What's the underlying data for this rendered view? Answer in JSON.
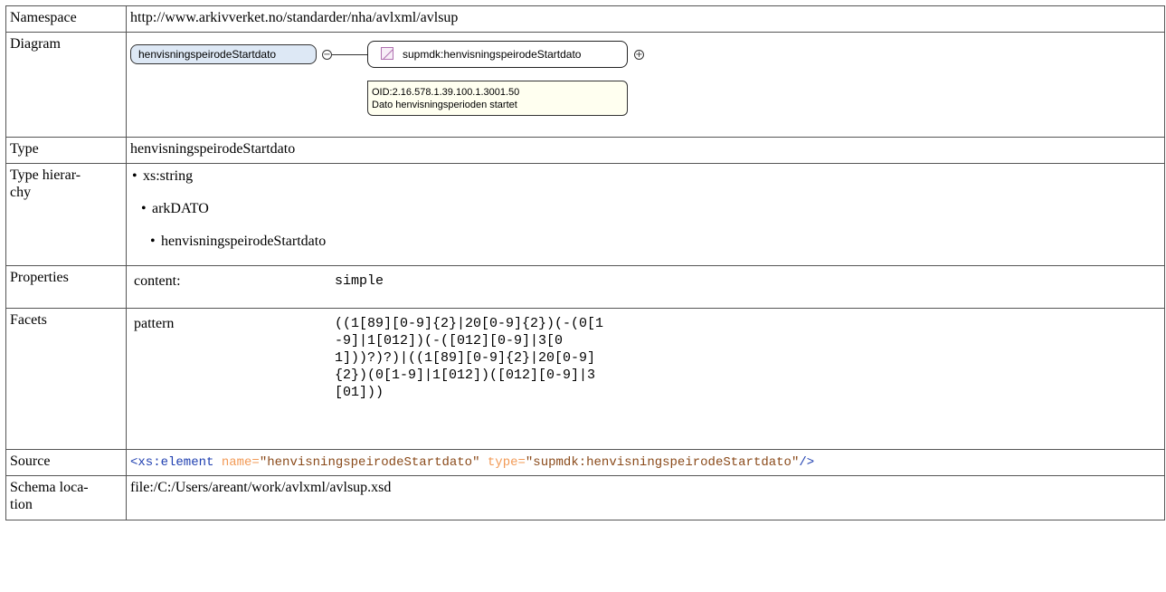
{
  "rows": {
    "namespace": {
      "label": "Namespace",
      "value": "http://www.arkivverket.no/standarder/nha/avlxml/avlsup"
    },
    "diagram": {
      "label": "Diagram",
      "element_name": "henvisningspeirodeStartdato",
      "type_name": "supmdk:henvisningspeirodeStartdato",
      "annotation_line1": "OID:2.16.578.1.39.100.1.3001.50",
      "annotation_line2": "Dato henvisningsperioden startet",
      "collapse_symbol": "−",
      "expand_symbol": "+"
    },
    "type": {
      "label": "Type",
      "value": "henvisningspeirodeStartdato"
    },
    "type_hierarchy": {
      "label_line1": "Type hierar-",
      "label_line2": "chy",
      "items": [
        "xs:string",
        "arkDATO",
        "henvisningspeirodeStartdato"
      ]
    },
    "properties": {
      "label": "Properties",
      "key": "content:",
      "value": "simple"
    },
    "facets": {
      "label": "Facets",
      "key": "pattern",
      "value": "((1[89][0-9]{2}|20[0-9]{2})(-(0[1-9]|1[012])(-([012][0-9]|3[01]))?)?)|((1[89][0-9]{2}|20[0-9]{2})(0[1-9]|1[012])([012][0-9]|3[01]))"
    },
    "source": {
      "label": "Source",
      "tag_open": "<xs:element",
      "attr1_name": "name=",
      "attr1_value": "\"henvisningspeirodeStartdato\"",
      "attr2_name": "type=",
      "attr2_value": "\"supmdk:henvisningspeirodeStartdato\"",
      "tag_close": "/>"
    },
    "schema_location": {
      "label_line1": "Schema loca-",
      "label_line2": "tion",
      "value": "file:/C:/Users/areant/work/avlxml/avlsup.xsd"
    }
  },
  "colors": {
    "element_fill": "#dde8f5",
    "annotation_fill": "#fffff0",
    "source_tag": "#1f3fb0",
    "source_attr": "#f29a56",
    "source_value": "#8a4a1a"
  }
}
